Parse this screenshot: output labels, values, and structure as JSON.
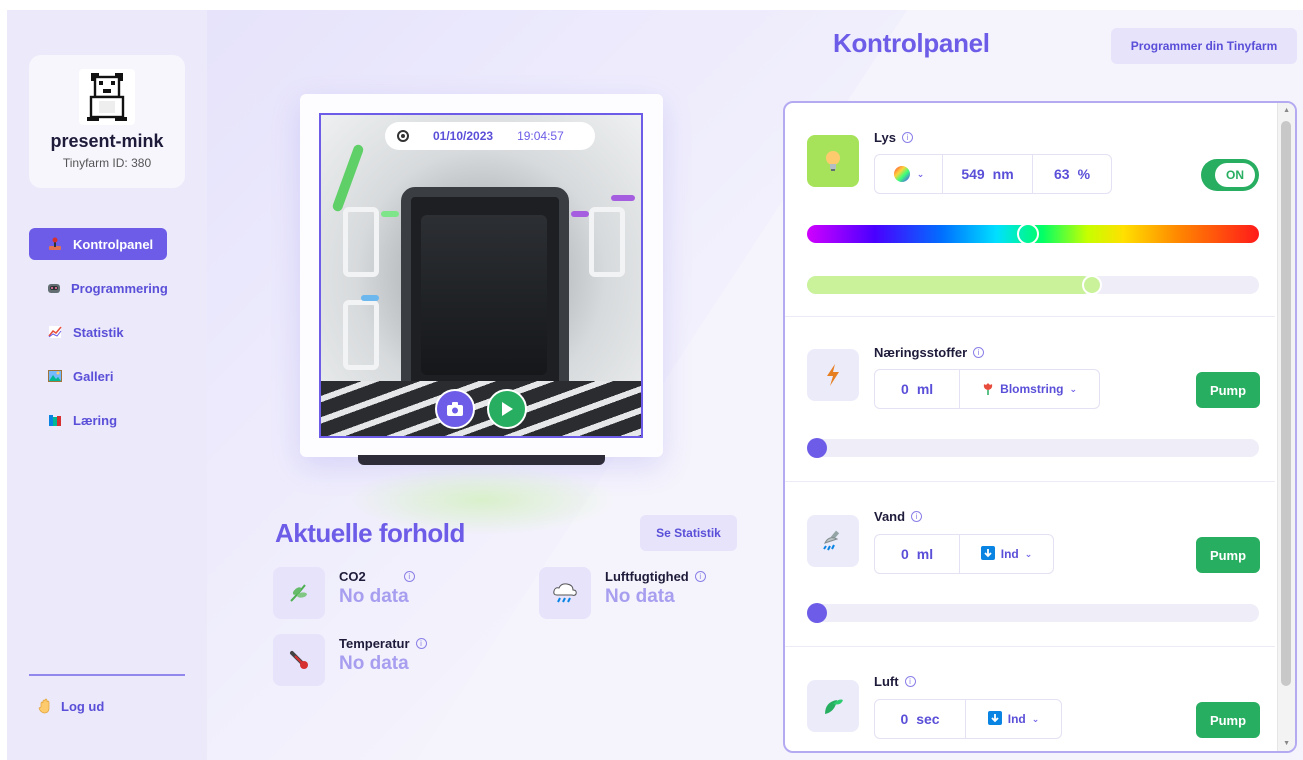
{
  "profile": {
    "name": "present-mink",
    "id_label": "Tinyfarm ID: 380",
    "avatar": "pixel-art-bear-icon"
  },
  "nav": {
    "items": [
      {
        "label": "Kontrolpanel",
        "icon": "joystick-icon",
        "active": true
      },
      {
        "label": "Programmering",
        "icon": "robot-icon",
        "active": false
      },
      {
        "label": "Statistik",
        "icon": "chart-icon",
        "active": false
      },
      {
        "label": "Galleri",
        "icon": "picture-icon",
        "active": false
      },
      {
        "label": "Læring",
        "icon": "books-icon",
        "active": false
      }
    ],
    "logout": "Log ud"
  },
  "camera": {
    "date": "01/10/2023",
    "time": "19:04:57"
  },
  "conditions": {
    "title": "Aktuelle forhold",
    "stats_button": "Se Statistik",
    "items": [
      {
        "label": "CO2",
        "value": "No data",
        "icon": "leaf-icon"
      },
      {
        "label": "Luftfugtighed",
        "value": "No data",
        "icon": "rain-cloud-icon"
      },
      {
        "label": "Temperatur",
        "value": "No data",
        "icon": "thermometer-icon"
      }
    ]
  },
  "panel": {
    "title": "Kontrolpanel",
    "program_button": "Programmer din Tinyfarm",
    "light": {
      "label": "Lys",
      "wavelength": "549",
      "wavelength_unit": "nm",
      "intensity": "63",
      "intensity_unit": "%",
      "toggle": "ON",
      "color_level": 0.49,
      "intensity_level": 0.63
    },
    "nutrients": {
      "label": "Næringsstoffer",
      "amount": "0",
      "unit": "ml",
      "type": "Blomstring",
      "pump": "Pump",
      "level": 0
    },
    "water": {
      "label": "Vand",
      "amount": "0",
      "unit": "ml",
      "direction": "Ind",
      "pump": "Pump",
      "level": 0
    },
    "air": {
      "label": "Luft",
      "amount": "0",
      "unit": "sec",
      "direction": "Ind",
      "pump": "Pump"
    }
  },
  "colors": {
    "accent": "#6c5ce7",
    "green": "#27ae60",
    "lime": "#c9f29b",
    "sidebar_bg": "#ebe9fa"
  }
}
